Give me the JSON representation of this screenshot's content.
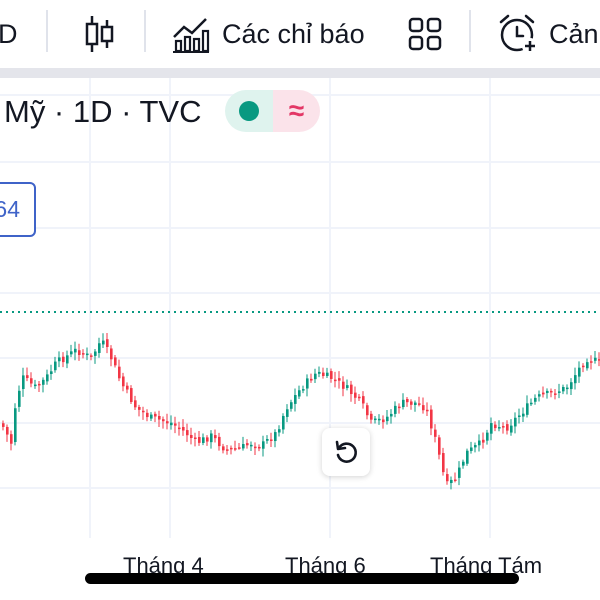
{
  "toolbar": {
    "partial_left": "D",
    "indicators_label": "Các chỉ báo",
    "alerts_label": "Cản",
    "icons": [
      "candlestick-icon",
      "indicators-icon",
      "layout-grid-icon",
      "alarm-clock-plus-icon"
    ]
  },
  "legend": {
    "symbol_text": "Mỹ · 1D · TVC",
    "status_colors": {
      "open": "#089981",
      "wave": "#e33766"
    }
  },
  "price_badge": {
    "text": "64"
  },
  "axis": {
    "x_labels": [
      "Tháng 4",
      "Tháng 6",
      "Tháng Tám"
    ]
  },
  "colors": {
    "up": "#089981",
    "down": "#f23645",
    "grid": "#f0f3fa",
    "price_line": "#089981",
    "badge": "#3f63c8"
  }
}
